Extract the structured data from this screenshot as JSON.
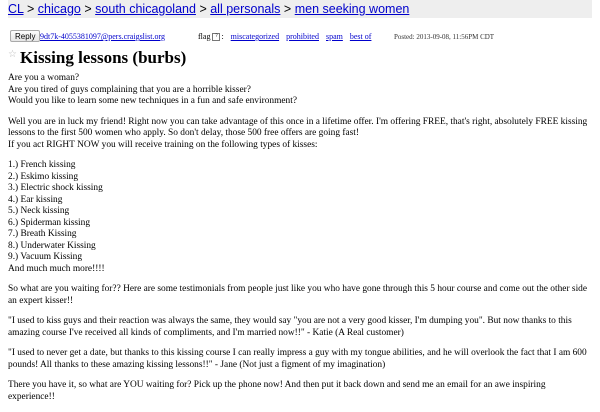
{
  "breadcrumbs": [
    {
      "label": "CL",
      "link": true
    },
    {
      "label": "chicago",
      "link": true
    },
    {
      "label": "south chicagoland",
      "link": true
    },
    {
      "label": "all personals",
      "link": true
    },
    {
      "label": "men seeking women",
      "link": true
    }
  ],
  "breadcrumb_separator": ">",
  "header": {
    "reply_label": "Reply",
    "reply_email": "9dt7k-4055381097@pers.craigslist.org",
    "flag_label": "flag",
    "flag_help": "?",
    "flag_links": [
      "miscategorized",
      "prohibited",
      "spam",
      "best of"
    ],
    "posted": "Posted: 2013-09-08, 11:56PM CDT"
  },
  "post": {
    "title": "Kissing lessons (burbs)",
    "intro": [
      "Are you a woman?",
      "Are you tired of guys complaining that you are a horrible kisser?",
      "Would you like to learn some new techniques in a fun and safe environment?"
    ],
    "offer": [
      "Well you are in luck my friend! Right now you can take advantage of this once in a lifetime offer. I'm offering FREE, that's right, absolutely FREE kissing",
      "lessons to the first 500 women who apply. So don't delay, those 500 free offers are going fast!",
      "If you act RIGHT NOW you will receive training on the following types of kisses:"
    ],
    "kisses": [
      "1.) French kissing",
      "2.) Eskimo kissing",
      "3.) Electric shock kissing",
      "4.) Ear kissing",
      "5.) Neck kissing",
      "6.) Spiderman kissing",
      "7.) Breath Kissing",
      "8.) Underwater Kissing",
      "9.) Vacuum Kissing",
      "And much much more!!!!"
    ],
    "waiting": [
      "So what are you waiting for?? Here are some testimonials from people just like you who have gone through this 5 hour course and come out the other side",
      "an expert kisser!!"
    ],
    "testimonial_1": [
      "\"I used to kiss guys and their reaction was always the same, they would say \"you are not a very good kisser, I'm dumping you\". But now thanks to this",
      "amazing course I've received all kinds of compliments, and I'm married now!!\" - Katie (A Real customer)"
    ],
    "testimonial_2": [
      "\"I used to never get a date, but thanks to this kissing course I can really impress a guy with my tongue abilities, and he will overlook the fact that I am 600",
      "pounds! All thanks to these amazing kissing lessons!!\" - Jane (Not just a figment of my imagination)"
    ],
    "closing": [
      "There you have it, so what are YOU waiting for? Pick up the phone now! And then put it back down and send me an email for an awe inspiring",
      "experience!!"
    ]
  }
}
